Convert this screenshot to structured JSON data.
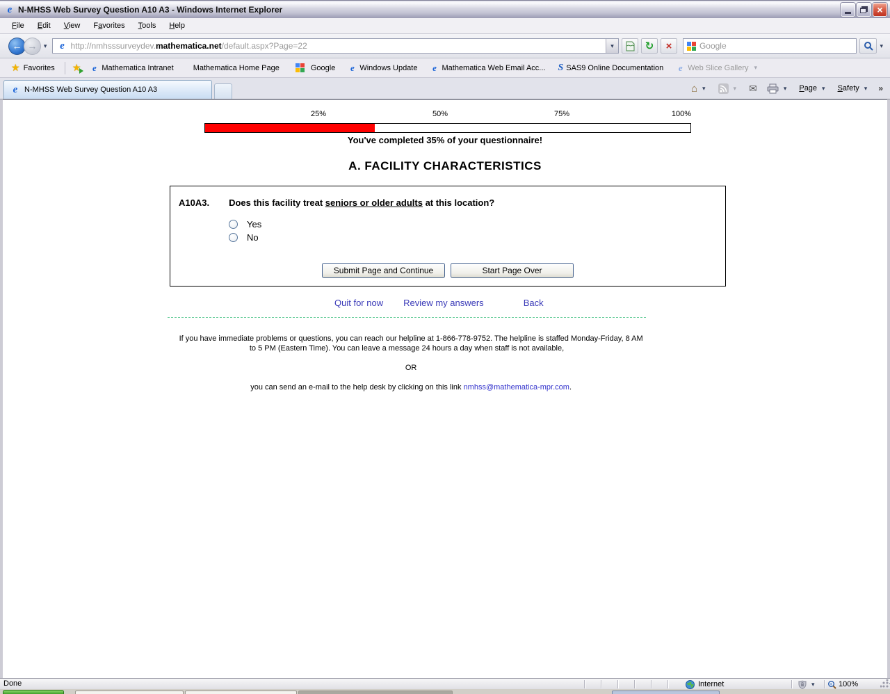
{
  "icons": {
    "favorites_star": "★",
    "home": "⌂",
    "mail": "✉",
    "refresh": "↻",
    "back_arrow": "←",
    "forward_arrow": "→",
    "stop_x": "×",
    "close_x": "×",
    "dropdown_arrow": "▾",
    "overflow_chevron": "»",
    "ie_e": "e",
    "sas_s": "S"
  },
  "window": {
    "title": "N-MHSS Web Survey Question A10 A3 - Windows Internet Explorer"
  },
  "menu_bar": {
    "items": [
      {
        "pre": "",
        "accel": "F",
        "post": "ile"
      },
      {
        "pre": "",
        "accel": "E",
        "post": "dit"
      },
      {
        "pre": "",
        "accel": "V",
        "post": "iew"
      },
      {
        "pre": "F",
        "accel": "a",
        "post": "vorites"
      },
      {
        "pre": "",
        "accel": "T",
        "post": "ools"
      },
      {
        "pre": "",
        "accel": "H",
        "post": "elp"
      }
    ]
  },
  "nav_bar": {
    "url_prefix": "http://nmhsssurveydev.",
    "url_domain": "mathematica.net",
    "url_suffix": "/default.aspx?Page=22",
    "search_placeholder": "Google"
  },
  "favorites_bar": {
    "label": "Favorites",
    "links": [
      {
        "label": "Mathematica Intranet"
      },
      {
        "label": "Mathematica Home Page"
      },
      {
        "label": "Google"
      },
      {
        "label": "Windows Update"
      },
      {
        "label": "Mathematica Web Email Acc..."
      },
      {
        "label": "SAS9 Online Documentation"
      },
      {
        "label": "Web Slice Gallery"
      }
    ]
  },
  "tab_bar": {
    "active_tab_title": "N-MHSS Web Survey Question A10 A3"
  },
  "command_bar": {
    "page": {
      "pre": "",
      "accel": "P",
      "post": "age"
    },
    "safety": {
      "pre": "",
      "accel": "S",
      "post": "afety"
    }
  },
  "survey": {
    "progress": {
      "tick_labels": [
        "25%",
        "50%",
        "75%",
        "100%"
      ],
      "percent_complete": 35,
      "message": "You've completed 35% of your questionnaire!",
      "fill_color": "#ff0000"
    },
    "section_heading": "A. FACILITY CHARACTERISTICS",
    "question": {
      "number": "A10A3.",
      "text_before": "Does this facility treat ",
      "text_underlined": "seniors or older adults",
      "text_after": " at this location?",
      "options": [
        {
          "label": "Yes"
        },
        {
          "label": "No"
        }
      ]
    },
    "buttons": {
      "submit": "Submit Page and Continue",
      "start_over": "Start Page Over"
    },
    "nav_links": {
      "quit": "Quit for now",
      "review": "Review my answers",
      "back": "Back"
    },
    "help": {
      "paragraph": "If you have immediate problems or questions, you can reach our helpline at 1-866-778-9752. The helpline is staffed Monday-Friday, 8 AM to 5 PM (Eastern Time). You can leave a message 24 hours a day when staff is not available,",
      "or_text": "OR",
      "email_prefix": "you can send an e-mail to the help desk by clicking on this link ",
      "email_link": "nmhss@mathematica-mpr.com",
      "email_suffix": "."
    },
    "colors": {
      "link_blue": "#3a3ab8",
      "dashed_separator": "#66cc99",
      "progress_red": "#ff0000"
    }
  },
  "status_bar": {
    "status": "Done",
    "zone": "Internet",
    "zoom_level": "100%"
  }
}
